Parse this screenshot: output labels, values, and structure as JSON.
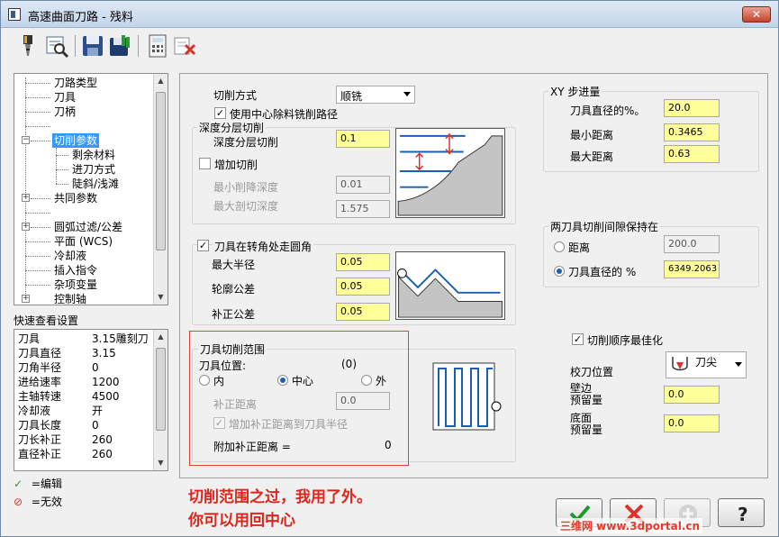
{
  "window": {
    "title": "高速曲面刀路 - 残料"
  },
  "toolbar": {
    "icons": [
      "tool-icon",
      "preview-icon",
      "save-icon",
      "save-lib-icon",
      "calculator-icon",
      "delete-icon"
    ]
  },
  "tree": {
    "items": [
      "刀路类型",
      "刀具",
      "刀柄",
      "切削参数",
      "剩余材料",
      "进刀方式",
      "陡斜/浅滩",
      "共同参数",
      "圆弧过滤/公差",
      "平面 (WCS)",
      "冷却液",
      "插入指令",
      "杂项变量",
      "控制轴"
    ]
  },
  "quickview": {
    "title": "快速查看设置",
    "rows": [
      {
        "k": "刀具",
        "v": "3.15雕刻刀"
      },
      {
        "k": "刀具直径",
        "v": "3.15"
      },
      {
        "k": "刀角半径",
        "v": "0"
      },
      {
        "k": "进给速率",
        "v": "1200"
      },
      {
        "k": "主轴转速",
        "v": "4500"
      },
      {
        "k": "冷却液",
        "v": "开"
      },
      {
        "k": "刀具长度",
        "v": "0"
      },
      {
        "k": "刀长补正",
        "v": "260"
      },
      {
        "k": "直径补正",
        "v": "260"
      }
    ]
  },
  "legend": {
    "edit": "=编辑",
    "invalid": "=无效"
  },
  "params": {
    "cut_method_label": "切削方式",
    "cut_method_value": "顺铣",
    "center_chk_label": "使用中心除料铣削路径",
    "depth_group_title": "深度分层切削",
    "depth_cut_label": "深度分层切削",
    "depth_cut_value": "0.1",
    "add_cut_label": "增加切削",
    "min_step_label": "最小削降深度",
    "min_step_value": "0.01",
    "max_cut_label": "最大剖切深度",
    "max_cut_value": "1.575",
    "corner_chk_label": "刀具在转角处走圆角",
    "max_radius_label": "最大半径",
    "max_radius_value": "0.05",
    "profile_tol_label": "轮廓公差",
    "profile_tol_value": "0.05",
    "offset_tol_label": "补正公差",
    "offset_tol_value": "0.05",
    "tool_range_title": "刀具切削范围",
    "tool_pos_label": "刀具位置:",
    "tool_pos_code": "(0)",
    "pos_in": "内",
    "pos_center": "中心",
    "pos_out": "外",
    "offset_dist_label": "补正距离",
    "offset_dist_value": "0.0",
    "add_offset_label": "增加补正距离到刀具半径",
    "extra_offset_label": "附加补正距离 =",
    "extra_offset_value": "0"
  },
  "xy_step": {
    "title": "XY 步进量",
    "tool_dia_pct_label": "刀具直径的%。",
    "tool_dia_pct_value": "20.0",
    "min_dist_label": "最小距离",
    "min_dist_value": "0.3465",
    "max_dist_label": "最大距离",
    "max_dist_value": "0.63"
  },
  "gap": {
    "title": "两刀具切削间隙保持在",
    "dist_label": "距离",
    "dist_value": "200.0",
    "pct_label": "刀具直径的 %",
    "pct_value": "6349.2063"
  },
  "misc": {
    "optimize_label": "切削顺序最佳化",
    "cal_pos_label": "校刀位置",
    "cal_pos_value": "刀尖",
    "wall_stock_label_1": "壁边",
    "wall_stock_label_2": "预留量",
    "wall_stock_value": "0.0",
    "floor_stock_label_1": "底面",
    "floor_stock_label_2": "预留量",
    "floor_stock_value": "0.0"
  },
  "note": {
    "line1": "切削范围之过，我用了外。",
    "line2": "你可以用回中心"
  },
  "watermark": "三维网 www.3dportal.cn",
  "colors": {
    "highlight": "#3399ff",
    "input_yellow": "#ffff99",
    "note_red": "#e0241c"
  }
}
